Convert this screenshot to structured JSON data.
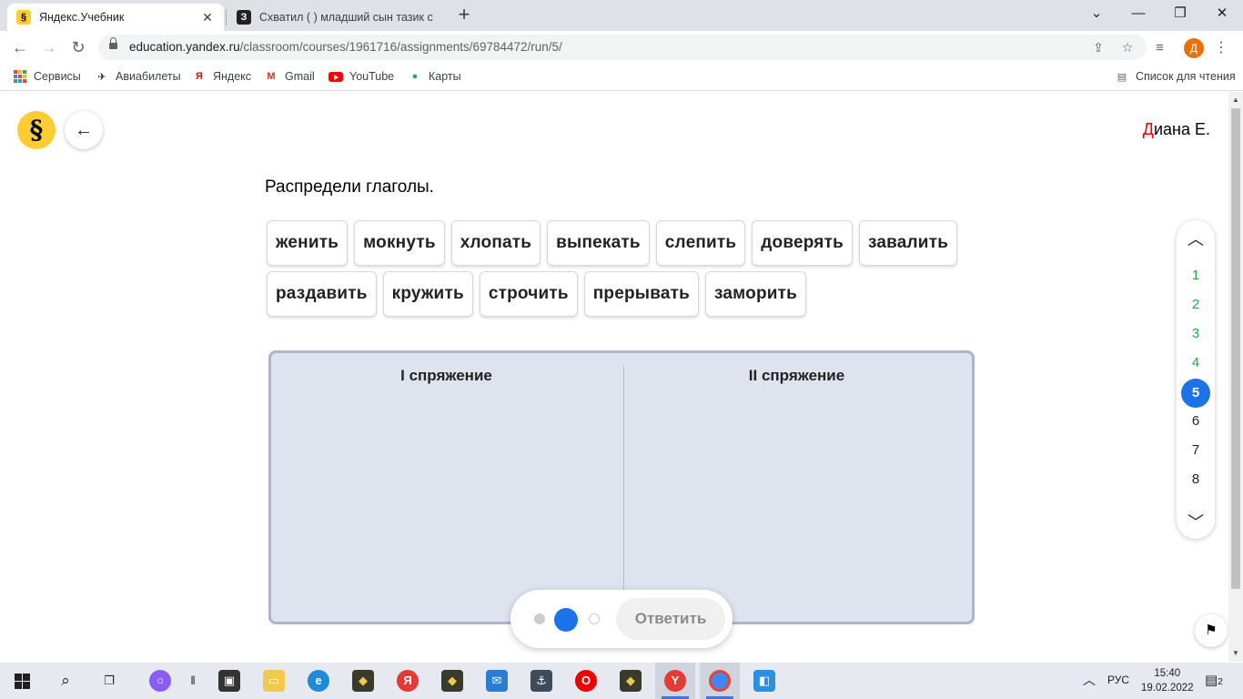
{
  "browser": {
    "tabs": [
      {
        "title": "Яндекс.Учебник",
        "active": true,
        "favicon": "yandex-uchebnik-icon"
      },
      {
        "title": "Схватил ( ) младший сын тазик с",
        "active": false,
        "favicon": "znanija-icon"
      }
    ],
    "url_host": "education.yandex.ru",
    "url_path": "/classroom/courses/1961716/assignments/69784472/run/5/",
    "profile_initial": "Д",
    "bookmarks": [
      {
        "label": "Сервисы",
        "icon": "apps-grid-icon"
      },
      {
        "label": "Авиабилеты",
        "icon": "plane-icon"
      },
      {
        "label": "Яндекс",
        "icon": "yandex-icon"
      },
      {
        "label": "Gmail",
        "icon": "gmail-icon"
      },
      {
        "label": "YouTube",
        "icon": "youtube-icon"
      },
      {
        "label": "Карты",
        "icon": "maps-pin-icon"
      }
    ],
    "reading_list": "Список для чтения"
  },
  "page": {
    "logo_glyph": "§",
    "user": {
      "first_letter": "Д",
      "rest": "иана Е."
    },
    "instruction": "Распредели глаголы.",
    "words_row1": [
      "женить",
      "мокнуть",
      "хлопать",
      "выпекать",
      "слепить",
      "доверять",
      "завалить"
    ],
    "words_row2": [
      "раздавить",
      "кружить",
      "строчить",
      "прерывать",
      "заморить"
    ],
    "columns": [
      {
        "title": "I спряжение"
      },
      {
        "title": "II спряжение"
      }
    ],
    "answer_button": "Ответить",
    "task_nav": {
      "items": [
        {
          "n": "1",
          "state": "done"
        },
        {
          "n": "2",
          "state": "done"
        },
        {
          "n": "3",
          "state": "done"
        },
        {
          "n": "4",
          "state": "done"
        },
        {
          "n": "5",
          "state": "current"
        },
        {
          "n": "6",
          "state": "todo"
        },
        {
          "n": "7",
          "state": "todo"
        },
        {
          "n": "8",
          "state": "todo"
        }
      ]
    }
  },
  "taskbar": {
    "language": "РУС",
    "time": "15:40",
    "date": "19.02.2022",
    "notifications": "2"
  },
  "colors": {
    "accent": "#1a73e8",
    "done": "#1da845",
    "logo": "#ffcc33",
    "board": "#dfe3ee"
  }
}
